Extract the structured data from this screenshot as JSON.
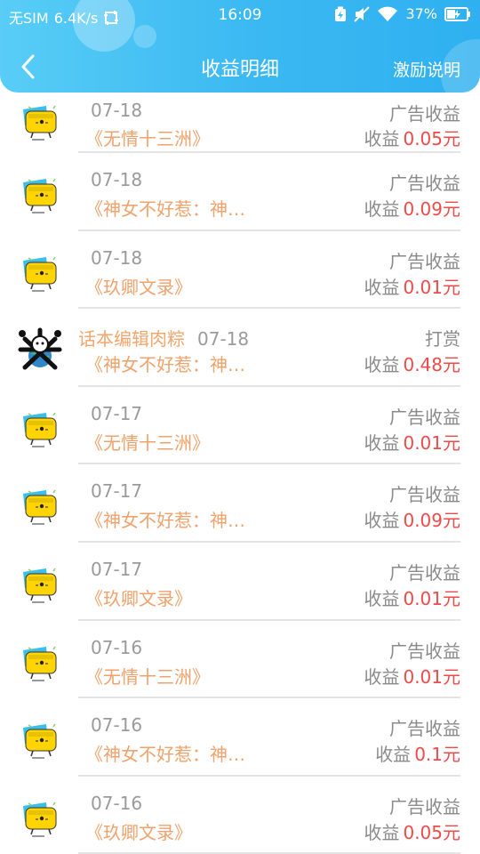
{
  "status_bar": {
    "carrier": "无SIM",
    "speed": "6.4K/s",
    "time": "16:09",
    "battery_percent": "37%"
  },
  "nav": {
    "title": "收益明细",
    "right_link": "激励说明"
  },
  "income_label": "收益",
  "records": [
    {
      "avatar": "robot-tv-icon",
      "author": "",
      "date": "07-18",
      "type": "广告收益",
      "book": "《无情十三洲》",
      "amount": "0.05元"
    },
    {
      "avatar": "robot-tv-icon",
      "author": "",
      "date": "07-18",
      "type": "广告收益",
      "book": "《神女不好惹：神…",
      "amount": "0.09元"
    },
    {
      "avatar": "robot-tv-icon",
      "author": "",
      "date": "07-18",
      "type": "广告收益",
      "book": "《玖卿文录》",
      "amount": "0.01元"
    },
    {
      "avatar": "user-avatar",
      "author": "话本编辑肉粽",
      "date": "07-18",
      "type": "打赏",
      "book": "《神女不好惹：神…",
      "amount": "0.48元"
    },
    {
      "avatar": "robot-tv-icon",
      "author": "",
      "date": "07-17",
      "type": "广告收益",
      "book": "《无情十三洲》",
      "amount": "0.01元"
    },
    {
      "avatar": "robot-tv-icon",
      "author": "",
      "date": "07-17",
      "type": "广告收益",
      "book": "《神女不好惹：神…",
      "amount": "0.09元"
    },
    {
      "avatar": "robot-tv-icon",
      "author": "",
      "date": "07-17",
      "type": "广告收益",
      "book": "《玖卿文录》",
      "amount": "0.01元"
    },
    {
      "avatar": "robot-tv-icon",
      "author": "",
      "date": "07-16",
      "type": "广告收益",
      "book": "《无情十三洲》",
      "amount": "0.01元"
    },
    {
      "avatar": "robot-tv-icon",
      "author": "",
      "date": "07-16",
      "type": "广告收益",
      "book": "《神女不好惹：神…",
      "amount": "0.1元"
    },
    {
      "avatar": "robot-tv-icon",
      "author": "",
      "date": "07-16",
      "type": "广告收益",
      "book": "《玖卿文录》",
      "amount": "0.05元"
    }
  ]
}
